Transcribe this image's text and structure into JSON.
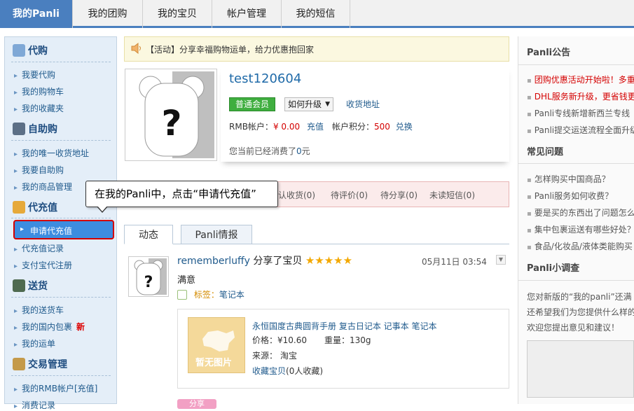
{
  "nav": {
    "tabs": [
      "我的Panli",
      "我的团购",
      "我的宝贝",
      "帐户管理",
      "我的短信"
    ]
  },
  "sidebar": {
    "daigou": {
      "title": "代购",
      "items": [
        "我要代购",
        "我的购物车",
        "我的收藏夹"
      ]
    },
    "zizhu": {
      "title": "自助购",
      "items": [
        "我的唯一收货地址",
        "我要自助购",
        "我的商品管理"
      ]
    },
    "chongzhi": {
      "title": "代充值",
      "highlighted": "申请代充值",
      "items": [
        "代充值记录",
        "支付宝代注册"
      ]
    },
    "songhuo": {
      "title": "送货",
      "items": [
        "我的送货车",
        "我的国内包裹",
        "我的运单"
      ],
      "new_badge": "新"
    },
    "jiaoyi": {
      "title": "交易管理",
      "items": [
        "我的RMB帐户[充值]",
        "消费记录"
      ]
    }
  },
  "notice": {
    "text": "【活动】分享幸福购物运单，给力优惠抱回家"
  },
  "profile": {
    "username": "test120604",
    "level": "普通会员",
    "upgrade": "如何升级",
    "address_link": "收货地址",
    "rmb_label": "RMB帐户：",
    "rmb_value": "¥ 0.00",
    "recharge": "充值",
    "points_label": "帐户积分：",
    "points_value": "500",
    "exchange": "兑换",
    "spent_prefix": "您当前已经消费了",
    "spent_value": "0",
    "spent_unit": "元"
  },
  "pending": {
    "items": [
      "认收货(0)",
      "待评价(0)",
      "待分享(0)",
      "未读短信(0)"
    ]
  },
  "tooltip": {
    "text": "在我的Panli中，点击“申请代充值”"
  },
  "tabs": {
    "dynamic": "动态",
    "news": "Panli情报"
  },
  "feed": {
    "user": "rememberluffy",
    "action": "分享了宝贝",
    "stars": "★★★★★",
    "time": "05月11日 03:54",
    "comment": "满意",
    "tag_label": "标签：",
    "tag_value": "笔记本",
    "product": {
      "image_text": "暂无图片",
      "title": "永恒国度古典圆背手册 复古日记本 记事本 笔记本",
      "price_label": "价格：",
      "price_value": "¥10.60",
      "weight_label": "重量：",
      "weight_value": "130g",
      "source_label": "来源：",
      "source_value": "淘宝",
      "collect": "收藏宝贝",
      "collect_count": "(0人收藏)"
    },
    "more_tag": "分享"
  },
  "right": {
    "announce_title": "Panli公告",
    "announcements": [
      {
        "text": "团购优惠活动开始啦！多重",
        "red": true
      },
      {
        "text": "DHL服务新升级，更省钱更",
        "red": true
      },
      {
        "text": "Panli专线新增新西兰专线",
        "red": false
      },
      {
        "text": "Panli提交运送流程全面升级",
        "red": false
      }
    ],
    "faq_title": "常见问题",
    "faqs": [
      "怎样购买中国商品？",
      "Panli服务如何收费？",
      "要是买的东西出了问题怎么",
      "集中包裹运送有哪些好处？",
      "食品/化妆品/液体类能购买"
    ],
    "survey_title": "Panli小调查",
    "survey_lines": [
      "您对新版的“我的panli”还满",
      "还希望我们为您提供什么样的",
      "欢迎您提出意见和建议！"
    ]
  }
}
